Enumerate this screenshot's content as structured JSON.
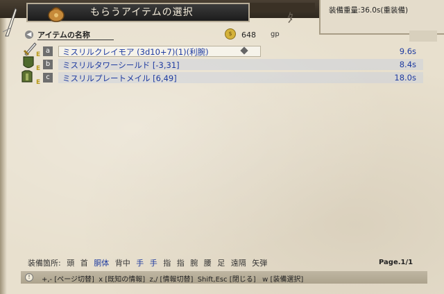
{
  "window": {
    "title": "もらうアイテムの選択"
  },
  "weight": {
    "top_partial": "",
    "text": "装備重量:36.0s(重装備)"
  },
  "header": {
    "name_label": "アイテムの名称",
    "gold": "648",
    "gold_unit": "gp",
    "right_tab": ""
  },
  "items": [
    {
      "key": "a",
      "name": "ミスリルクレイモア (3d10+7)(1)(利腕)",
      "weight": "9.6s"
    },
    {
      "key": "b",
      "name": "ミスリルタワーシールド [-3,31]",
      "weight": "8.4s"
    },
    {
      "key": "c",
      "name": "ミスリルプレートメイル [6,49]",
      "weight": "18.0s"
    }
  ],
  "slots": {
    "label": "装備箇所:",
    "list": [
      "頭",
      "首",
      "胴体",
      "背中",
      "手",
      "手",
      "指",
      "指",
      "腕",
      "腰",
      "足",
      "遠隔",
      "矢弾"
    ]
  },
  "page": "Page.1/1",
  "help": "+,- [ページ切替]  x [既知の情報]  z,/ [情報切替]  Shift,Esc [閉じる]   w [装備選択]",
  "colors": {
    "item_text": "#1e3ba0",
    "parchment": "#e8e0ce",
    "title_bg": "#1c1c1c"
  }
}
